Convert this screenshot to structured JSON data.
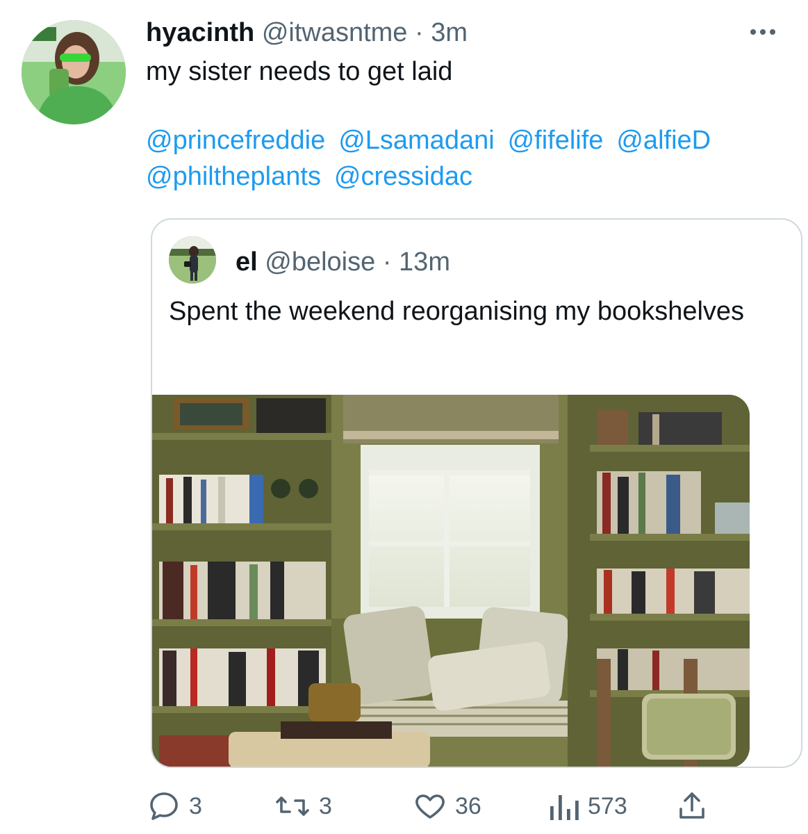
{
  "tweet": {
    "author_name": "hyacinth",
    "handle": "@itwasntme",
    "separator": "·",
    "time": "3m",
    "text": "my sister needs to get laid",
    "mentions": [
      "@princefreddie",
      "@Lsamadani",
      "@fifelife",
      "@alfieD",
      "@philtheplants",
      "@cressidac"
    ],
    "avatar_icon": "user-avatar-photo",
    "more_icon": "more-options-icon"
  },
  "quoted": {
    "author_name": "el",
    "handle": "@beloise",
    "separator": "·",
    "time": "13m",
    "text": "Spent the weekend reorganising my bookshelves",
    "image_desc_icon": "photo-bookshelves"
  },
  "actions": {
    "replies": "3",
    "retweets": "3",
    "likes": "36",
    "views": "573"
  },
  "colors": {
    "link": "#1d9bf0",
    "secondary": "#536471",
    "border": "#cfd9de",
    "primary_text": "#0f1419"
  }
}
